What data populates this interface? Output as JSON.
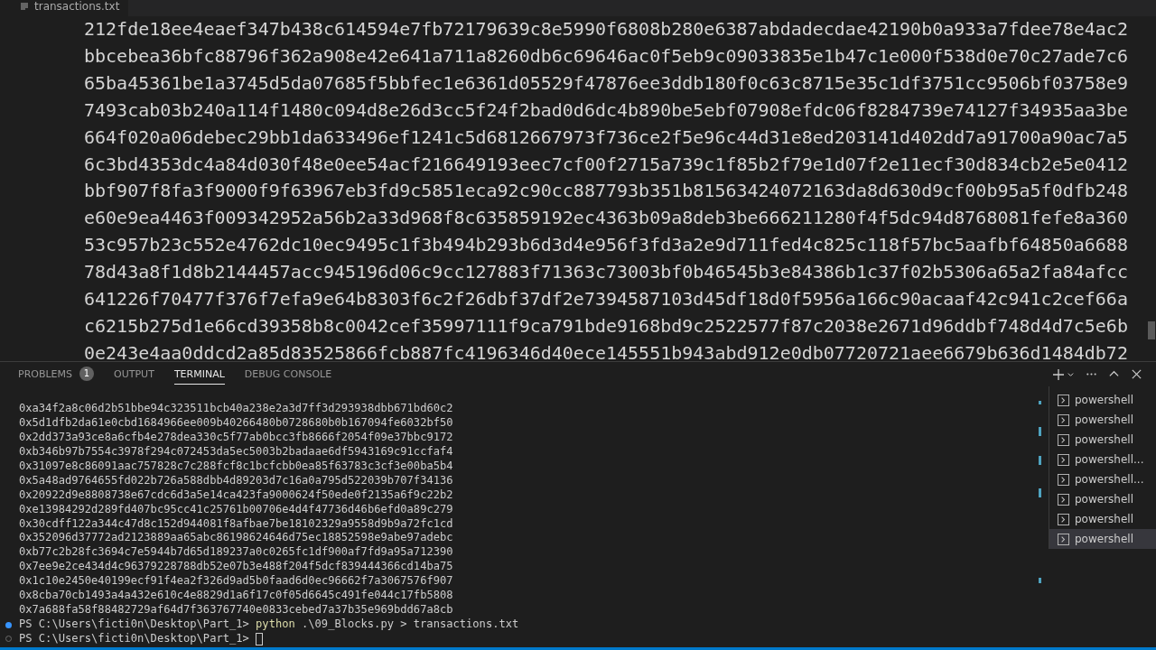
{
  "editor": {
    "tab": {
      "label": "transactions.txt"
    },
    "lines": [
      "212fde18ee4eaef347b438c614594e7fb72179639c8e5990f6808b280e6387abdadecdae42190b0a933a7fdee78e4ac2",
      "bbcebea36bfc88796f362a908e42e641a711a8260db6c69646ac0f5eb9c09033835e1b47c1e000f538d0e70c27ade7c6",
      "65ba45361be1a3745d5da07685f5bbfec1e6361d05529f47876ee3ddb180f0c63c8715e35c1df3751cc9506bf03758e9",
      "7493cab03b240a114f1480c094d8e26d3cc5f24f2bad0d6dc4b890be5ebf07908efdc06f8284739e74127f34935aa3be",
      "664f020a06debec29bb1da633496ef1241c5d6812667973f736ce2f5e96c44d31e8ed203141d402dd7a91700a90ac7a5",
      "6c3bd4353dc4a84d030f48e0ee54acf216649193eec7cf00f2715a739c1f85b2f79e1d07f2e11ecf30d834cb2e5e0412",
      "bbf907f8fa3f9000f9f63967eb3fd9c5851eca92c90cc887793b351b81563424072163da8d630d9cf00b95a5f0dfb248",
      "e60e9ea4463f009342952a56b2a33d968f8c635859192ec4363b09a8deb3be666211280f4f5dc94d8768081fefe8a360",
      "53c957b23c552e4762dc10ec9495c1f3b494b293b6d3d4e956f3fd3a2e9d711fed4c825c118f57bc5aafbf64850a6688",
      "78d43a8f1d8b2144457acc945196d06c9cc127883f71363c73003bf0b46545b3e84386b1c37f02b5306a65a2fa84afcc",
      "641226f70477f376f7efa9e64b8303f6c2f26dbf37df2e7394587103d45df18d0f5956a166c90acaaf42c941c2cef66a",
      "c6215b275d1e66cd39358b8c0042cef35997111f9ca791bde9168bd9c2522577f87c2038e2671d96ddbf748d4d7c5e6b",
      "0e243e4aa0ddcd2a85d83525866fcb887fc4196346d40ece145551b943abd912e0db07720721aee6679b636d1484db72"
    ]
  },
  "panel": {
    "tabs": [
      {
        "label": "PROBLEMS",
        "badge": "1",
        "selected": false
      },
      {
        "label": "OUTPUT",
        "selected": false
      },
      {
        "label": "TERMINAL",
        "selected": true
      },
      {
        "label": "DEBUG CONSOLE",
        "selected": false
      }
    ],
    "terminal": {
      "output": [
        "0xa34f2a8c06d2b51bbe94c323511bcb40a238e2a3d7ff3d293938dbb671bd60c2",
        "0x5d1dfb2da61e0cbd1684966ee009b40266480b0728680b0b167094fe6032bf50",
        "0x2dd373a93ce8a6cfb4e278dea330c5f77ab0bcc3fb8666f2054f09e37bbc9172",
        "0xb346b97b7554c3978f294c072453da5ec5003b2badaae6df5943169c91ccfaf4",
        "0x31097e8c86091aac757828c7c288fcf8c1bcfcbb0ea85f63783c3cf3e00ba5b4",
        "0x5a48ad9764655fd022b726a588dbb4d89203d7c16a0a795d522039b707f34136",
        "0x20922d9e8808738e67cdc6d3a5e14ca423fa9000624f50ede0f2135a6f9c22b2",
        "0xe13984292d289fd407bc95cc41c25761b00706e4d4f47736d46b6efd0a89c279",
        "0x30cdff122a344c47d8c152d944081f8afbae7be18102329a9558d9b9a72fc1cd",
        "0x352096d37772ad2123889aa65abc86198624646d75ec18852598e9abe97adebc",
        "0xb77c2b28fc3694c7e5944b7d65d189237a0c0265fc1df900af7fd9a95a712390",
        "0x7ee9e2ce434d4c96379228788db52e07b3e488f204f5dcf839444366cd14ba75",
        "0x1c10e2450e40199ecf91f4ea2f326d9ad5b0faad6d0ec96662f7a3067576f907",
        "0x8cba70cb1493a4a432e610c4e8829d1a6f17c0f05d6645c491fe044c17fb5808",
        "0x7a688fa58f88482729af64d7f363767740e0833cebed7a37b35e969bdd67a8cb"
      ],
      "commands": [
        {
          "kind": "finished",
          "prompt": "PS C:\\Users\\ficti0n\\Desktop\\Part_1>",
          "program": "python",
          "args": ".\\09_Blocks.py > transactions.txt"
        },
        {
          "kind": "current",
          "prompt": "PS C:\\Users\\ficti0n\\Desktop\\Part_1>"
        }
      ]
    },
    "terminals": [
      {
        "label": "powershell",
        "selected": false
      },
      {
        "label": "powershell",
        "selected": false
      },
      {
        "label": "powershell",
        "selected": false
      },
      {
        "label": "powershell...",
        "selected": false
      },
      {
        "label": "powershell...",
        "selected": false
      },
      {
        "label": "powershell",
        "selected": false
      },
      {
        "label": "powershell",
        "selected": false
      },
      {
        "label": "powershell",
        "selected": true
      }
    ]
  }
}
